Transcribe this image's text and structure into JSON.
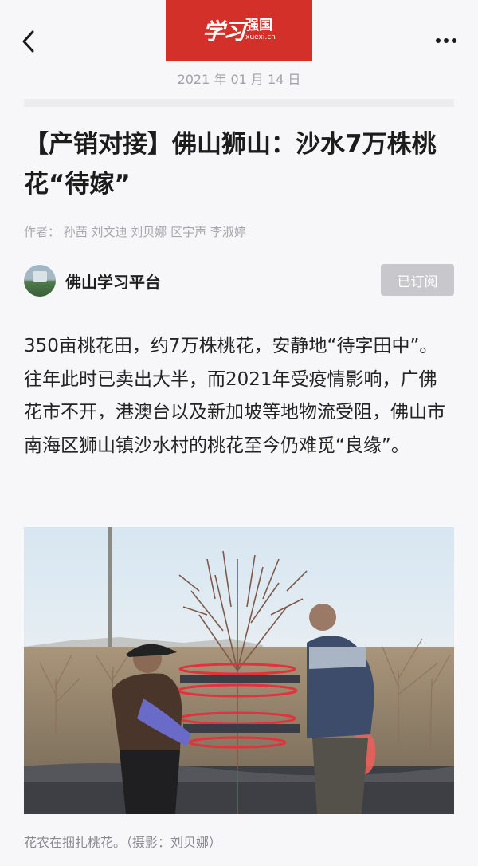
{
  "header": {
    "logo_script": "学习",
    "logo_cn": "强国",
    "logo_url": "xuexi.cn",
    "back_icon": "chevron-left-icon",
    "more_icon": "more-dots-icon"
  },
  "article": {
    "date": "2021 年 01 月 14 日",
    "title": "【产销对接】佛山狮山：沙水7万株桃花“待嫁”",
    "authors": "作者：  孙茜  刘文迪  刘贝娜  区宇声  李淑婷",
    "source_name": "佛山学习平台",
    "subscribe_label": "已订阅",
    "body": "350亩桃花田，约7万株桃花，安静地“待字田中”。往年此时已卖出大半，而2021年受疫情影响，广佛花市不开，港澳台以及新加坡等地物流受阻，佛山市南海区狮山镇沙水村的桃花至今仍难觅“良缘”。",
    "photo_caption": "花农在捆扎桃花。（摄影：刘贝娜）"
  },
  "colors": {
    "brand_red": "#d3302a",
    "background": "#f7f7f9",
    "subscribed_button": "#c8c8cc"
  }
}
